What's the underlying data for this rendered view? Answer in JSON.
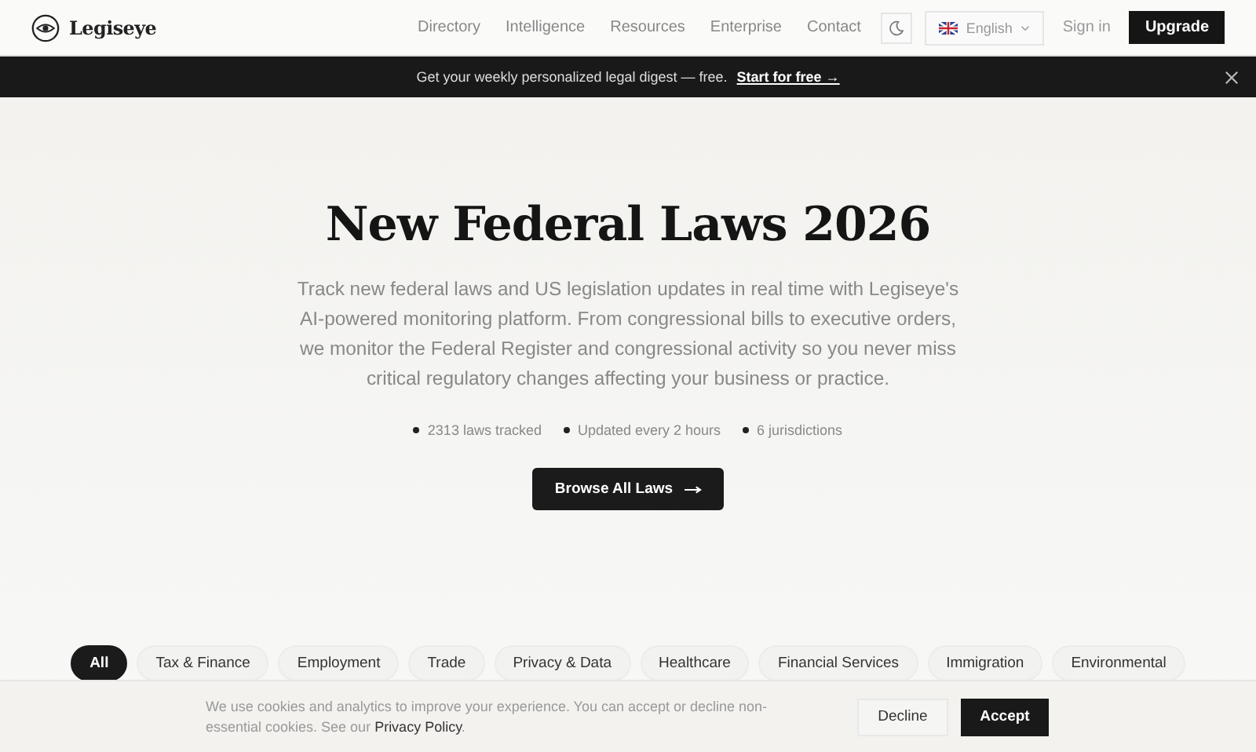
{
  "header": {
    "logo": "Legiseye",
    "nav": [
      "Directory",
      "Intelligence",
      "Resources",
      "Enterprise",
      "Contact"
    ],
    "language": "English",
    "sign_in": "Sign in",
    "upgrade": "Upgrade"
  },
  "promo_bar": {
    "text": "Get your weekly personalized legal digest — free.",
    "link": "Start for free →"
  },
  "hero": {
    "title": "New Federal Laws 2026",
    "description": "Track new federal laws and US legislation updates in real time with Legiseye's AI-powered monitoring platform. From congressional bills to executive orders, we monitor the Federal Register and congressional activity so you never miss critical regulatory changes affecting your business or practice.",
    "stats": [
      "2313 laws tracked",
      "Updated every 2 hours",
      "6 jurisdictions"
    ],
    "button": "Browse All Laws"
  },
  "filters": [
    {
      "label": "All",
      "selected": true
    },
    {
      "label": "Tax & Finance",
      "selected": false
    },
    {
      "label": "Employment",
      "selected": false
    },
    {
      "label": "Trade",
      "selected": false
    },
    {
      "label": "Privacy & Data",
      "selected": false
    },
    {
      "label": "Healthcare",
      "selected": false
    },
    {
      "label": "Financial Services",
      "selected": false
    },
    {
      "label": "Immigration",
      "selected": false
    },
    {
      "label": "Environmental",
      "selected": false
    }
  ],
  "cookie_banner": {
    "text": "We use cookies and analytics to improve your experience. You can accept or decline non-essential cookies. See our",
    "link": "Privacy Policy",
    "after": ".",
    "decline": "Decline",
    "accept": "Accept"
  }
}
